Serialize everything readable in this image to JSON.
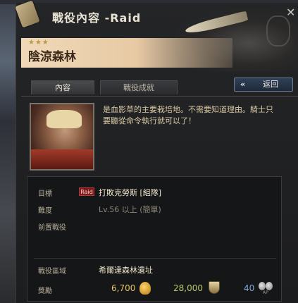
{
  "window": {
    "title": "戰役內容 -Raid"
  },
  "banner": {
    "stars": "★★★",
    "location": "陰涼森林"
  },
  "tabs": [
    {
      "label": "內容",
      "active": true
    },
    {
      "label": "戰役成就",
      "active": false
    }
  ],
  "back_button": {
    "icon": "«",
    "label": "返回"
  },
  "description": "是血影草的主要栽培地。不需要知道理由。騎士只要聽從命令執行就可以了！",
  "info": {
    "objective": {
      "label": "目標",
      "badge": "Raid",
      "value": "打敗克勞斯 [組隊]"
    },
    "difficulty": {
      "label": "難度",
      "value": "Lv.56 以上 (簡單)"
    },
    "prerequisite": {
      "label": "前置戰役",
      "value": ""
    },
    "area": {
      "label": "戰役區域",
      "value": "希爾達森林遺址"
    },
    "reward": {
      "label": "獎勵",
      "gold": "6,700",
      "exp": "28,000",
      "ap": "40",
      "ap_label": "AP"
    }
  },
  "colors": {
    "gold": "#e5c46a",
    "exp": "#b8c870",
    "ap": "#7fa6d6",
    "raid_badge": "#7a1d1d"
  }
}
